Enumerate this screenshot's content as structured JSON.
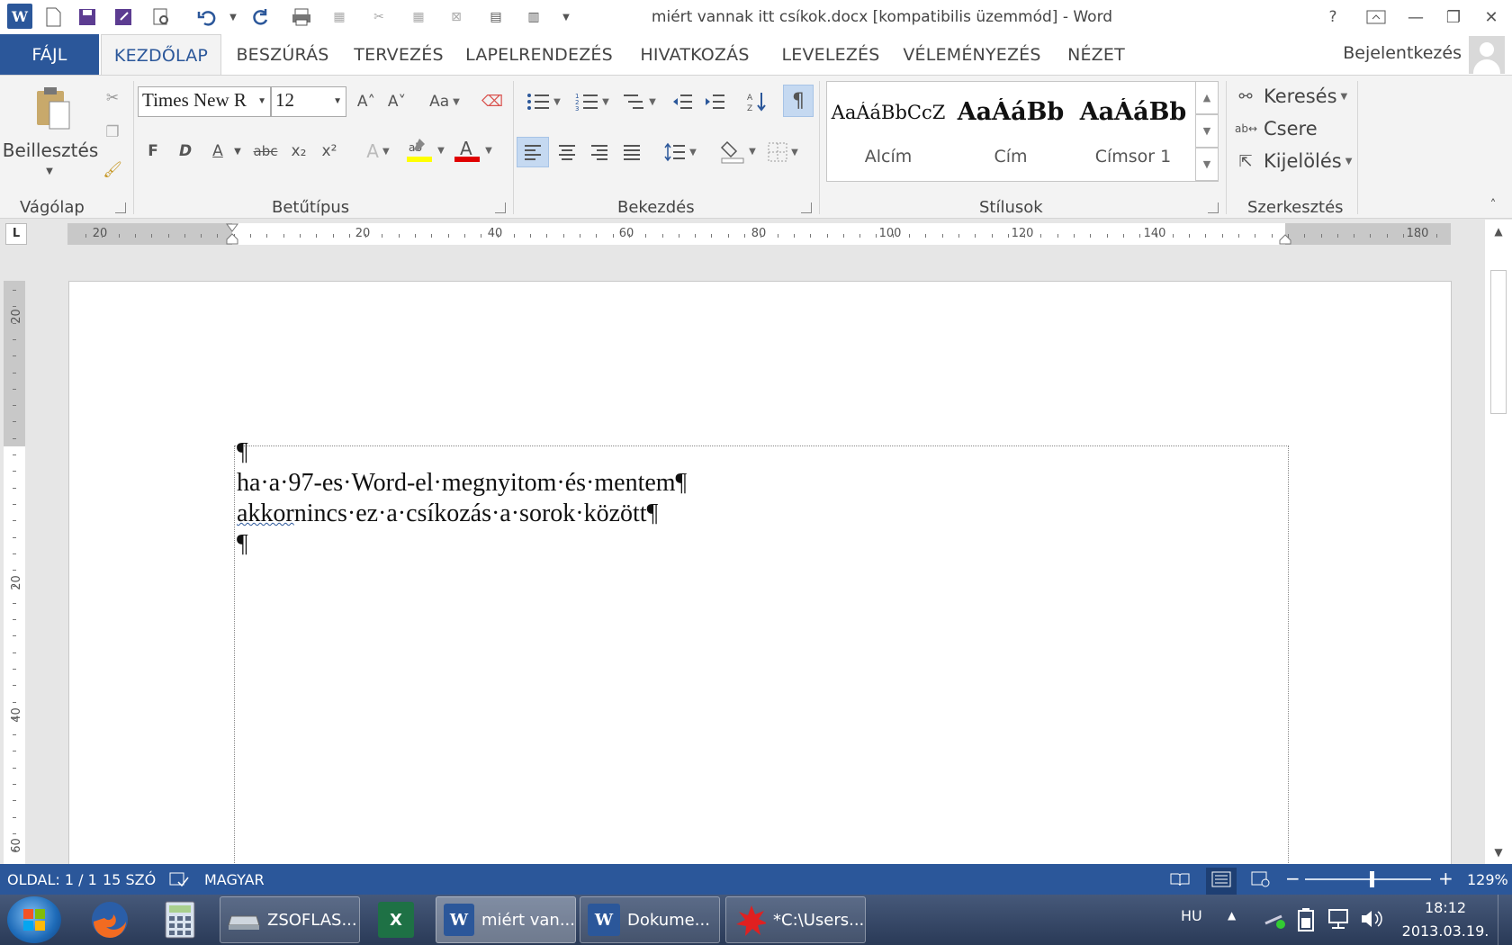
{
  "window": {
    "title": "miért vannak itt csíkok.docx [kompatibilis üzemmód] - Word",
    "help": "?",
    "minimize": "—",
    "maximize": "❐",
    "close": "✕"
  },
  "tabs": [
    {
      "label": "FÁJL"
    },
    {
      "label": "KEZDŐLAP"
    },
    {
      "label": "BESZÚRÁS"
    },
    {
      "label": "TERVEZÉS"
    },
    {
      "label": "LAPELRENDEZÉS"
    },
    {
      "label": "HIVATKOZÁS"
    },
    {
      "label": "LEVELEZÉS"
    },
    {
      "label": "VÉLEMÉNYEZÉS"
    },
    {
      "label": "NÉZET"
    }
  ],
  "signin": "Bejelentkezés",
  "ribbon": {
    "clipboard": {
      "label": "Vágólap",
      "paste": "Beillesztés"
    },
    "font": {
      "label": "Betűtípus",
      "font_name": "Times New R",
      "font_size": "12",
      "bold": "F",
      "italic": "D",
      "underline": "A",
      "strike": "abc",
      "sub": "x₂",
      "sup": "x²",
      "grow": "A˄",
      "shrink": "A˅",
      "case": "Aa"
    },
    "paragraph": {
      "label": "Bekezdés",
      "pilcrow": "¶"
    },
    "styles": {
      "label": "Stílusok",
      "items": [
        {
          "preview": "AaÁáBbCcZ",
          "name": "Alcím"
        },
        {
          "preview": "AaÁáBb",
          "name": "Cím"
        },
        {
          "preview": "AaÁáBb",
          "name": "Címsor 1"
        }
      ]
    },
    "editing": {
      "label": "Szerkesztés",
      "find": "Keresés",
      "replace": "Csere",
      "select": "Kijelölés"
    }
  },
  "ruler": {
    "tab_selector": "L",
    "h_labels": [
      "20",
      "20",
      "40",
      "60",
      "80",
      "100",
      "120",
      "140",
      "180"
    ],
    "v_labels": [
      "20",
      "20",
      "40",
      "60"
    ]
  },
  "document": {
    "lines": [
      "¶",
      "ha·a·97-es·Word-el·megnyitom·és·mentem¶",
      "nincs·ez·a·csíkozás·a·sorok·között¶",
      "¶"
    ],
    "spell_word": "akkor"
  },
  "status": {
    "page": "OLDAL: 1 / 1",
    "words": "15 SZÓ",
    "language": "MAGYAR",
    "zoom": "129%",
    "zoom_minus": "−",
    "zoom_plus": "+"
  },
  "taskbar": {
    "items": [
      {
        "label": "ZSOFLAS..."
      },
      {
        "label": "miért van..."
      },
      {
        "label": "Dokume..."
      },
      {
        "label": "*C:\\Users..."
      }
    ],
    "lang": "HU",
    "time": "18:12",
    "date": "2013.03.19."
  },
  "colors": {
    "accent": "#2b579a",
    "highlight": "#ffff00",
    "font_color": "#e00000"
  }
}
